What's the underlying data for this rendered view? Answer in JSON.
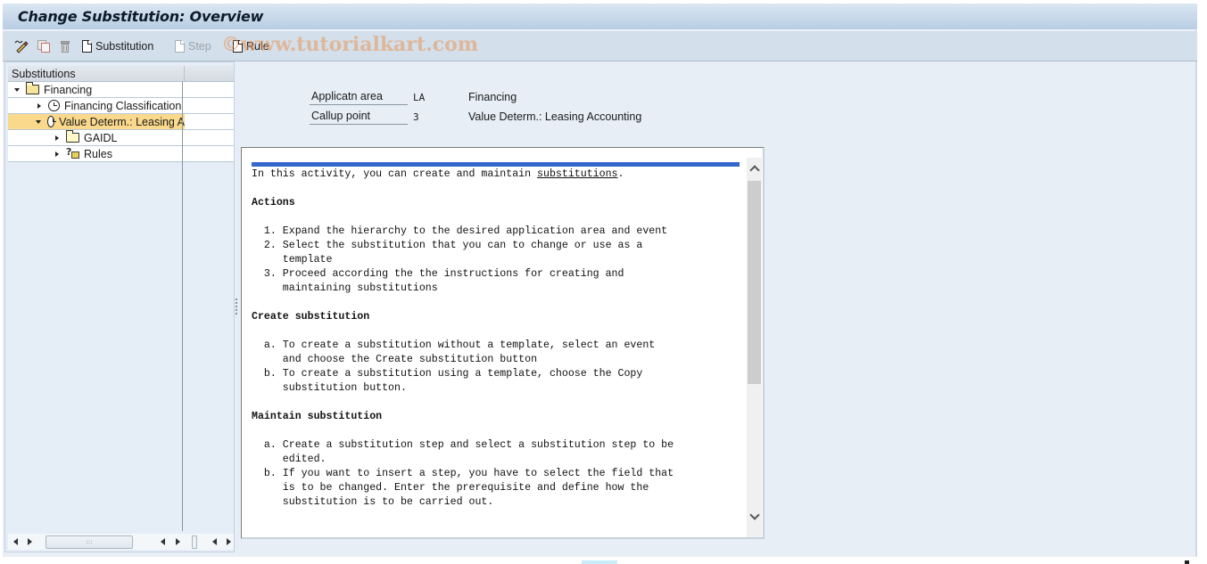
{
  "window": {
    "title": "Change Substitution: Overview"
  },
  "toolbar": {
    "items": [
      {
        "icon": "edit-pencil-icon",
        "label": "",
        "enabled": true
      },
      {
        "icon": "copy-icon",
        "label": "",
        "enabled": false
      },
      {
        "icon": "delete-trash-icon",
        "label": "",
        "enabled": false
      },
      {
        "icon": "new-document-icon",
        "label": "Substitution",
        "enabled": true
      },
      {
        "icon": "new-document-icon",
        "label": "Step",
        "enabled": false
      },
      {
        "icon": "new-document-icon",
        "label": "Rule",
        "enabled": true
      }
    ],
    "watermark": "©www.tutorialkart.com"
  },
  "tree": {
    "header": "Substitutions",
    "rows": [
      {
        "label": "Financing",
        "level": 0,
        "expander": "expanded",
        "icon": "folder-open-icon",
        "selected": false
      },
      {
        "label": "Financing Classification",
        "level": 1,
        "expander": "collapsed",
        "icon": "clock-icon",
        "selected": false
      },
      {
        "label": "Value Determ.: Leasing A",
        "level": 1,
        "expander": "expanded",
        "icon": "clock-icon",
        "selected": true
      },
      {
        "label": "GAIDL",
        "level": 2,
        "expander": "collapsed",
        "icon": "folder-icon",
        "selected": false
      },
      {
        "label": "Rules",
        "level": 2,
        "expander": "collapsed",
        "icon": "rules-icon",
        "selected": false
      }
    ],
    "scroll_thumb_grip": ":::"
  },
  "header_fields": [
    {
      "label": "Applicatn area",
      "value": "LA",
      "description": "Financing"
    },
    {
      "label": "Callup point",
      "value": "3",
      "description": "Value Determ.: Leasing Accounting"
    }
  ],
  "document": {
    "intro_before": "In this activity, you can create and maintain ",
    "intro_link": "substitutions",
    "intro_after": ".",
    "sections": [
      {
        "heading": "Actions",
        "items": [
          {
            "marker": "1.",
            "lines": [
              "Expand the hierarchy to the desired application area and event"
            ]
          },
          {
            "marker": "2.",
            "lines": [
              "Select the substitution that you can to change or use as a",
              "template"
            ]
          },
          {
            "marker": "3.",
            "lines": [
              "Proceed according the the instructions for creating and",
              "maintaining substitutions"
            ]
          }
        ]
      },
      {
        "heading": "Create substitution",
        "items": [
          {
            "marker": "a.",
            "lines": [
              "To create a substitution without a template, select an event",
              "and choose the Create substitution button"
            ]
          },
          {
            "marker": "b.",
            "lines": [
              "To create a substitution using a template, choose the Copy",
              "substitution button."
            ]
          }
        ]
      },
      {
        "heading": "Maintain substitution",
        "items": [
          {
            "marker": "a.",
            "lines": [
              "Create a substitution step and select a substitution step to be",
              "edited."
            ]
          },
          {
            "marker": "b.",
            "lines": [
              "If you want to insert a step, you have to select the field that",
              "is to be changed. Enter the prerequisite and define how the",
              "substitution is to be carried out."
            ]
          }
        ]
      }
    ]
  },
  "colors": {
    "selected_row": "#fbd98c",
    "doc_top_bar": "#3466cc",
    "window_bg": "#e7eef6",
    "titlebar": "#b8cde3"
  }
}
